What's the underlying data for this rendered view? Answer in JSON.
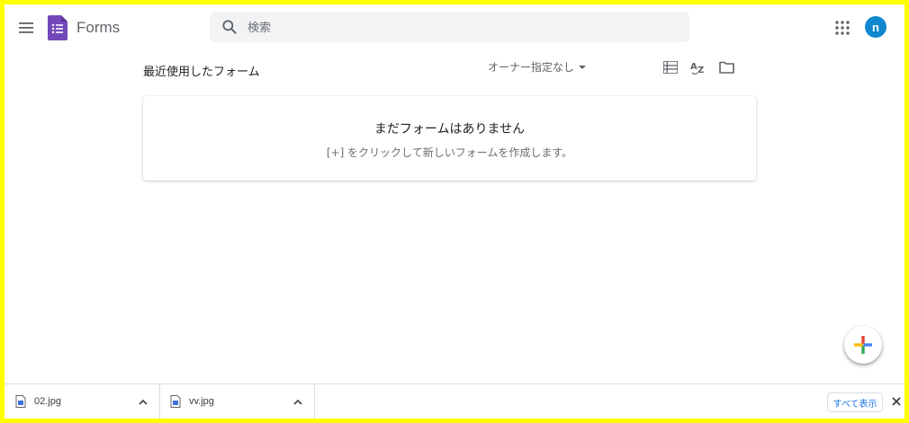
{
  "header": {
    "app_title": "Forms",
    "search_placeholder": "検索",
    "avatar_initial": "n",
    "menu_icon": "hamburger-menu-icon",
    "apps_icon": "apps-grid-icon"
  },
  "toolbar": {
    "section_title": "最近使用したフォーム",
    "owner_filter": "オーナー指定なし",
    "icons": [
      "list-view-icon",
      "sort-az-icon",
      "folder-icon"
    ]
  },
  "empty_state": {
    "title": "まだフォームはありません",
    "subtitle": "[+] をクリックして新しいフォームを作成します。"
  },
  "fab": {
    "icon": "plus-icon"
  },
  "download_bar": {
    "items": [
      {
        "name": "02.jpg",
        "icon": "image-file-icon"
      },
      {
        "name": "vv.jpg",
        "icon": "image-file-icon"
      }
    ],
    "show_all_label": "すべて表示"
  },
  "colors": {
    "forms_purple": "#7248b9",
    "avatar_blue": "#1187d0",
    "link_blue": "#1a73e8",
    "border_yellow": "#ffff00"
  }
}
